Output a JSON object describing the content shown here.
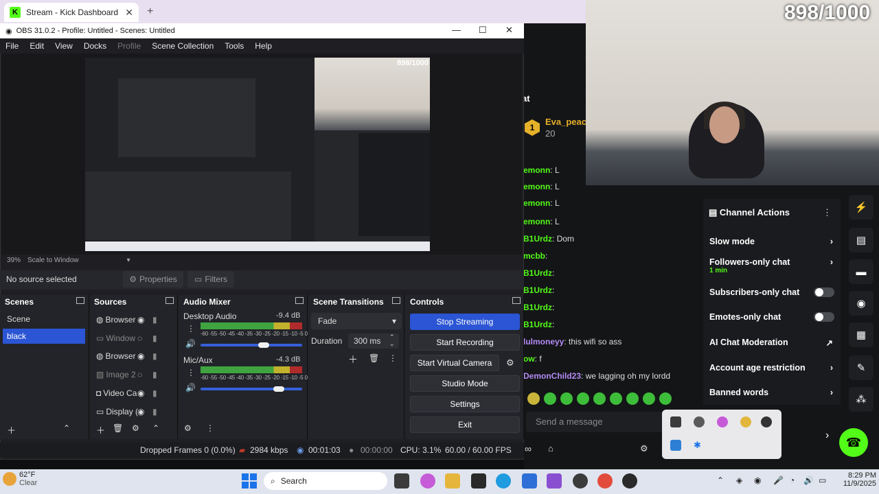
{
  "browser": {
    "tab_title": "Stream - Kick Dashboard",
    "new_tab": "+"
  },
  "overlay": {
    "goal_counter": "898/1000"
  },
  "kick": {
    "chat_header": "at",
    "gift": {
      "rank": "1",
      "user": "Eva_peach",
      "count": "20"
    },
    "chat": [
      {
        "user": "emonn",
        "text": "L"
      },
      {
        "user": "emonn",
        "text": "L"
      },
      {
        "user": "emonn",
        "text": "L"
      },
      {
        "user": "emonn",
        "text": "L"
      },
      {
        "user": "B1Urdz",
        "text": "Dom"
      },
      {
        "user": "mcbb",
        "text": ""
      },
      {
        "user": "B1Urdz",
        "text": ""
      },
      {
        "user": "B1Urdz",
        "text": ""
      },
      {
        "user": "B1Urdz",
        "text": ""
      },
      {
        "user": "B1Urdz",
        "text": ""
      },
      {
        "user": "lulmoneyy",
        "text": "this wifi so ass"
      },
      {
        "user": "ow",
        "text": "f"
      },
      {
        "user": "DemonChild23",
        "text": "we lagging oh my lordd"
      }
    ],
    "message_placeholder": "Send a message",
    "channel_actions": {
      "title": "Channel Actions",
      "items": [
        {
          "label": "Slow mode",
          "sub": "",
          "kind": "arrow"
        },
        {
          "label": "Followers-only chat",
          "sub": "1 min",
          "kind": "arrow"
        },
        {
          "label": "Subscribers-only chat",
          "sub": "",
          "kind": "toggle"
        },
        {
          "label": "Emotes-only chat",
          "sub": "",
          "kind": "toggle"
        },
        {
          "label": "AI Chat Moderation",
          "sub": "",
          "kind": "external"
        },
        {
          "label": "Account age restriction",
          "sub": "",
          "kind": "arrow"
        },
        {
          "label": "Banned words",
          "sub": "",
          "kind": "arrow"
        }
      ]
    }
  },
  "obs": {
    "title": "OBS 31.0.2 - Profile: Untitled - Scenes: Untitled",
    "menu": [
      "File",
      "Edit",
      "View",
      "Docks",
      "Profile",
      "Scene Collection",
      "Tools",
      "Help"
    ],
    "preview": {
      "zoom": "39%",
      "scale_mode": "Scale to Window"
    },
    "no_source": "No source selected",
    "properties": "Properties",
    "filters": "Filters",
    "docks": {
      "scenes": {
        "title": "Scenes",
        "items": [
          "Scene",
          "black"
        ],
        "selected": "black"
      },
      "sources": {
        "title": "Sources",
        "items": [
          "Browser",
          "Window",
          "Browser",
          "Image 2",
          "Video Ca",
          "Display ("
        ]
      },
      "mixer": {
        "title": "Audio Mixer",
        "channels": [
          {
            "name": "Desktop Audio",
            "db": "-9.4 dB",
            "level": 0.62
          },
          {
            "name": "Mic/Aux",
            "db": "-4.3 dB",
            "level": 0.77
          }
        ],
        "scale": "-60 -55 -50 -45 -40 -35 -30 -25 -20 -15 -10 -5 0"
      },
      "transitions": {
        "title": "Scene Transitions",
        "type": "Fade",
        "duration_label": "Duration",
        "duration": "300 ms"
      },
      "controls": {
        "title": "Controls",
        "stop_streaming": "Stop Streaming",
        "start_recording": "Start Recording",
        "start_virtual_camera": "Start Virtual Camera",
        "studio_mode": "Studio Mode",
        "settings": "Settings",
        "exit": "Exit"
      }
    },
    "status": {
      "dropped": "Dropped Frames 0 (0.0%)",
      "bitrate": "2984 kbps",
      "stream_time": "00:01:03",
      "rec_time": "00:00:00",
      "cpu": "CPU: 3.1%",
      "fps": "60.00 / 60.00 FPS"
    }
  },
  "taskbar": {
    "weather_temp": "62°F",
    "weather_cond": "Clear",
    "search": "Search",
    "time": "8:29 PM",
    "date": "11/9/2025"
  },
  "colors": {
    "kick_green": "#53fc18",
    "obs_blue": "#2b55d4"
  }
}
